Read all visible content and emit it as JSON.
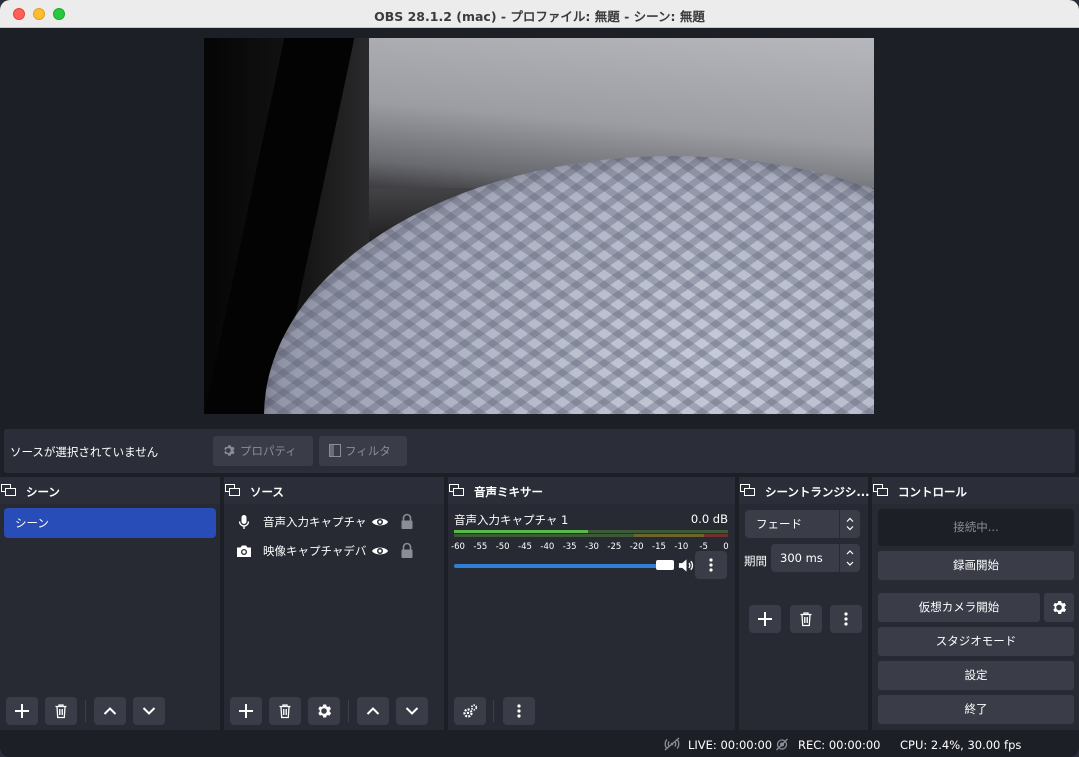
{
  "window": {
    "title": "OBS 28.1.2 (mac) - プロファイル: 無題 - シーン: 無題"
  },
  "context_bar": {
    "no_source_label": "ソースが選択されていません",
    "properties_label": "プロパティ",
    "filters_label": "フィルタ"
  },
  "scenes_dock": {
    "title": "シーン",
    "items": [
      "シーン"
    ]
  },
  "sources_dock": {
    "title": "ソース",
    "items": [
      {
        "label": "音声入力キャプチャ",
        "icon": "microphone-icon"
      },
      {
        "label": "映像キャプチャデバ",
        "icon": "camera-icon"
      }
    ]
  },
  "mixer_dock": {
    "title": "音声ミキサー",
    "channel_name": "音声入力キャプチャ 1",
    "level_db": "0.0 dB",
    "meter_level_fraction": 0.49,
    "volume_fraction": 1.0,
    "ticks": [
      "-60",
      "-55",
      "-50",
      "-45",
      "-40",
      "-35",
      "-30",
      "-25",
      "-20",
      "-15",
      "-10",
      "-5",
      "0"
    ]
  },
  "transitions_dock": {
    "title": "シーントランジシ...",
    "transition": "フェード",
    "duration_label": "期間",
    "duration_value": "300 ms"
  },
  "controls_dock": {
    "title": "コントロール",
    "connecting_label": "接続中...",
    "record_label": "録画開始",
    "virtual_camera_label": "仮想カメラ開始",
    "studio_mode_label": "スタジオモード",
    "settings_label": "設定",
    "exit_label": "終了"
  },
  "status_bar": {
    "live": "LIVE: 00:00:00",
    "rec": "REC: 00:00:00",
    "cpu": "CPU: 2.4%, 30.00 fps"
  },
  "colors": {
    "accent": "#284cb8",
    "slider": "#2f7fd9",
    "meter_green": "#58b848",
    "meter_yellow": "#c8b43c",
    "meter_red": "#c84040"
  }
}
